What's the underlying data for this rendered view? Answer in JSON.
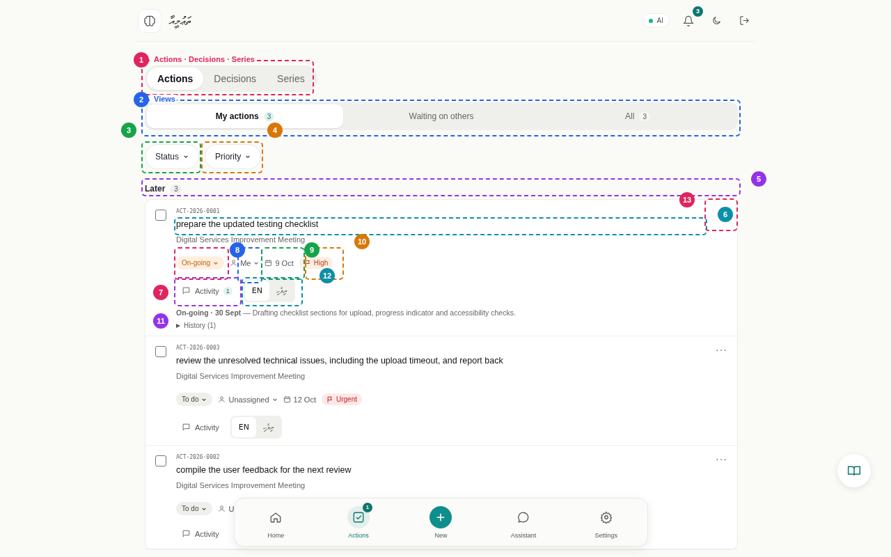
{
  "header": {
    "logo_text": "ތަޢުމީއާ",
    "ai_label": "AI",
    "ai_on": true,
    "notifications": "3"
  },
  "section_tabs": [
    {
      "label": "Actions",
      "selected": true
    },
    {
      "label": "Decisions",
      "selected": false
    },
    {
      "label": "Series",
      "selected": false
    }
  ],
  "views": [
    {
      "label": "My actions",
      "count": "3",
      "selected": true
    },
    {
      "label": "Waiting on others",
      "selected": false
    },
    {
      "label": "All",
      "count": "3",
      "selected": false
    }
  ],
  "filters": [
    "Status",
    "Priority"
  ],
  "group": {
    "label": "Later",
    "count": "3"
  },
  "actions": [
    {
      "id": "ACT-2026-0001",
      "title": "prepare the updated testing checklist",
      "meeting": "Digital Services Improvement Meeting",
      "checked": false,
      "status": {
        "label": "On-going",
        "kind": "ongoing"
      },
      "assignee": {
        "label": "Me",
        "dropdown": true
      },
      "due": "9 Oct",
      "priority": {
        "label": "High",
        "kind": "high"
      },
      "activity": "Activity",
      "activity_count": "1",
      "languages": [
        {
          "label": "EN",
          "selected": true
        },
        {
          "label": "ދިވެހި",
          "selected": false
        }
      ],
      "note": "**On-going · 30 Sept** — Drafting checklist sections for upload, progress indicator and accessibility checks.",
      "history": {
        "label": "History (1)",
        "expanded": false
      }
    },
    {
      "id": "ACT-2026-0003",
      "title": "review the unresolved technical issues, including the upload timeout, and report back",
      "meeting": "Digital Services Improvement Meeting",
      "checked": false,
      "menu": "···",
      "status": {
        "label": "To do",
        "kind": "todo"
      },
      "assignee": {
        "label": "Unassigned",
        "dropdown": true
      },
      "due": "12 Oct",
      "priority": {
        "label": "Urgent",
        "kind": "urgent"
      },
      "activity": "Activity",
      "languages": [
        {
          "label": "EN",
          "selected": true
        },
        {
          "label": "ދިވެހި",
          "selected": false
        }
      ]
    },
    {
      "id": "ACT-2026-0002",
      "title": "compile the user feedback for the next review",
      "meeting": "Digital Services Improvement Meeting",
      "checked": false,
      "menu": "···",
      "status": {
        "label": "To do",
        "kind": "todo"
      },
      "assignee": {
        "label": "U",
        "dropdown": false
      },
      "activity": "Activity"
    }
  ],
  "bottom_nav": [
    {
      "label": "Home",
      "kind": "home",
      "selected": false
    },
    {
      "label": "Actions",
      "kind": "actions",
      "selected": true,
      "badge": "1"
    },
    {
      "label": "New",
      "kind": "new",
      "selected": false
    },
    {
      "label": "Assistant",
      "kind": "assistant",
      "selected": false
    },
    {
      "label": "Settings",
      "kind": "settings",
      "selected": false
    }
  ],
  "annotations": [
    {
      "number": "1",
      "color": "#e0245e",
      "label": "Actions · Decisions · Series"
    },
    {
      "number": "2",
      "color": "#2563eb",
      "label": "Views"
    },
    {
      "number": "3",
      "color": "#16a34a"
    },
    {
      "number": "4",
      "color": "#d97706"
    },
    {
      "number": "5",
      "color": "#9333ea"
    },
    {
      "number": "6",
      "color": "#0e8fa8"
    },
    {
      "number": "7",
      "color": "#e0245e"
    },
    {
      "number": "8",
      "color": "#2563eb"
    },
    {
      "number": "9",
      "color": "#16a34a"
    },
    {
      "number": "10",
      "color": "#d97706"
    },
    {
      "number": "11",
      "color": "#9333ea"
    },
    {
      "number": "12",
      "color": "#0e8fa8"
    },
    {
      "number": "13",
      "color": "#e0245e"
    }
  ]
}
